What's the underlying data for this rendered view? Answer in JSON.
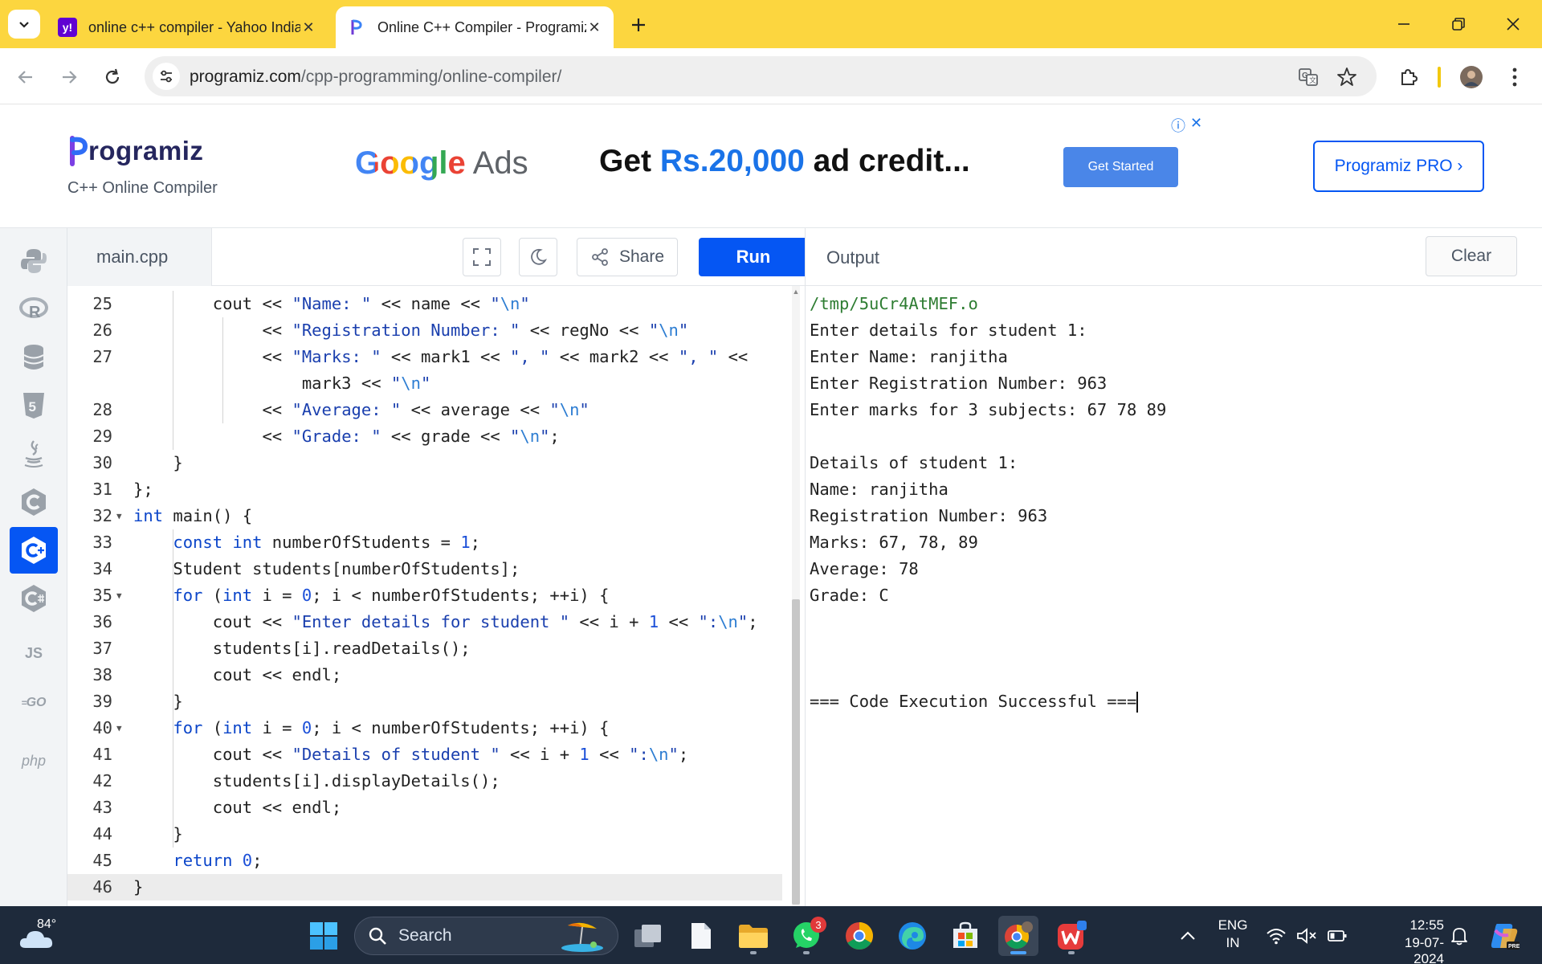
{
  "browser": {
    "tabs": [
      {
        "title": "online c++ compiler - Yahoo India Search Results",
        "favicon": "yahoo-icon",
        "active": false
      },
      {
        "title": "Online C++ Compiler - Programiz",
        "favicon": "programiz-icon",
        "active": true
      }
    ],
    "address": {
      "domain": "programiz.com",
      "path": "/cpp-programming/online-compiler/"
    }
  },
  "site": {
    "logo_text": "rogramiz",
    "logo_initial": "P",
    "subtitle": "C++ Online Compiler",
    "ad": {
      "brand_google": "Google",
      "brand_ads": "Ads",
      "headline_pre": "Get ",
      "headline_highlight": "Rs.20,000",
      "headline_post": " ad credit...",
      "cta": "Get Started"
    },
    "pro_button": "Programiz PRO ›"
  },
  "languages": [
    "python",
    "r",
    "sql",
    "html",
    "java",
    "c",
    "cpp",
    "csharp",
    "js",
    "go",
    "php"
  ],
  "languages_labels": {
    "js": "JS",
    "go": "GO",
    "php": "php"
  },
  "editor": {
    "file_name": "main.cpp",
    "share_label": "Share",
    "run_label": "Run",
    "lines": [
      {
        "n": "25",
        "html": "        cout << \"Name: \" << name << \"\\n\""
      },
      {
        "n": "26",
        "html": "             << \"Registration Number: \" << regNo << \"\\n\""
      },
      {
        "n": "27",
        "html": "             << \"Marks: \" << mark1 << \", \" << mark2 << \", \" <<"
      },
      {
        "n": "",
        "html": "                 mark3 << \"\\n\""
      },
      {
        "n": "28",
        "html": "             << \"Average: \" << average << \"\\n\""
      },
      {
        "n": "29",
        "html": "             << \"Grade: \" << grade << \"\\n\";"
      },
      {
        "n": "30",
        "html": "    }"
      },
      {
        "n": "31",
        "html": "};"
      },
      {
        "n": "32",
        "html": "int main() {"
      },
      {
        "n": "33",
        "html": "    const int numberOfStudents = 1;"
      },
      {
        "n": "34",
        "html": "    Student students[numberOfStudents];"
      },
      {
        "n": "35",
        "html": "    for (int i = 0; i < numberOfStudents; ++i) {"
      },
      {
        "n": "36",
        "html": "        cout << \"Enter details for student \" << i + 1 << \":\\n\";"
      },
      {
        "n": "37",
        "html": "        students[i].readDetails();"
      },
      {
        "n": "38",
        "html": "        cout << endl;"
      },
      {
        "n": "39",
        "html": "    }"
      },
      {
        "n": "40",
        "html": "    for (int i = 0; i < numberOfStudents; ++i) {"
      },
      {
        "n": "41",
        "html": "        cout << \"Details of student \" << i + 1 << \":\\n\";"
      },
      {
        "n": "42",
        "html": "        students[i].displayDetails();"
      },
      {
        "n": "43",
        "html": "        cout << endl;"
      },
      {
        "n": "44",
        "html": "    }"
      },
      {
        "n": "45",
        "html": "    return 0;"
      },
      {
        "n": "46",
        "html": "}"
      }
    ]
  },
  "output": {
    "title": "Output",
    "clear_label": "Clear",
    "lines": [
      "/tmp/5uCr4AtMEF.o",
      "Enter details for student 1:",
      "Enter Name: ranjitha",
      "Enter Registration Number: 963",
      "Enter marks for 3 subjects: 67 78 89",
      "",
      "Details of student 1:",
      "Name: ranjitha",
      "Registration Number: 963",
      "Marks: 67, 78, 89",
      "Average: 78",
      "Grade: C",
      "",
      "",
      "",
      "=== Code Execution Successful ==="
    ]
  },
  "taskbar": {
    "temperature": "84°",
    "search_placeholder": "Search",
    "whatsapp_badge": "3",
    "lang_top": "ENG",
    "lang_bottom": "IN",
    "time": "12:55",
    "date": "19-07-2024"
  }
}
